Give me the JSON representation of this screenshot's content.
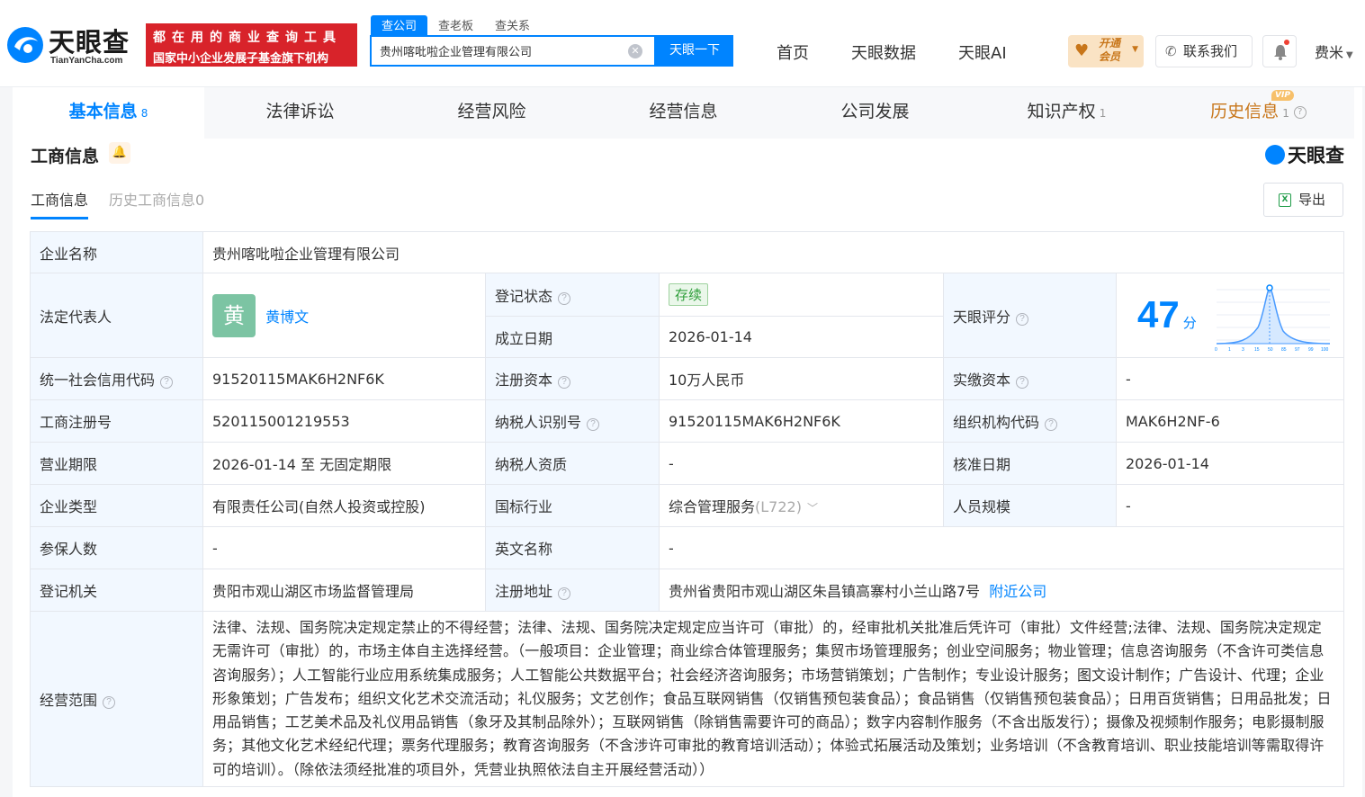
{
  "header": {
    "logo_text": "天眼查",
    "logo_sub": "TianYanCha.com",
    "banner_line1": "都在用的商业查询工具",
    "banner_line2": "国家中小企业发展子基金旗下机构",
    "search_tabs": [
      "查公司",
      "查老板",
      "查关系"
    ],
    "search_value": "贵州喀吡啦企业管理有限公司",
    "search_button": "天眼一下",
    "nav": [
      "首页",
      "天眼数据",
      "天眼AI"
    ],
    "vip_line1": "开通",
    "vip_line2": "会员",
    "contact": "联系我们",
    "user": "费米"
  },
  "main_tabs": [
    {
      "label": "基本信息",
      "count": "8"
    },
    {
      "label": "法律诉讼",
      "count": ""
    },
    {
      "label": "经营风险",
      "count": ""
    },
    {
      "label": "经营信息",
      "count": ""
    },
    {
      "label": "公司发展",
      "count": ""
    },
    {
      "label": "知识产权",
      "count": "1"
    },
    {
      "label": "历史信息",
      "count": "1",
      "badge": "VIP"
    }
  ],
  "section": {
    "title": "工商信息",
    "brand": "天眼查",
    "sub_tabs": [
      "工商信息",
      "历史工商信息0"
    ],
    "export": "导出"
  },
  "info": {
    "company_name_label": "企业名称",
    "company_name": "贵州喀吡啦企业管理有限公司",
    "legal_rep_label": "法定代表人",
    "legal_rep_avatar": "黄",
    "legal_rep": "黄博文",
    "reg_status_label": "登记状态",
    "reg_status": "存续",
    "found_date_label": "成立日期",
    "found_date": "2026-01-14",
    "score_label": "天眼评分",
    "score": "47",
    "score_unit": "分",
    "score_axis": [
      "0",
      "1",
      "3",
      "15",
      "50",
      "85",
      "97",
      "99",
      "100"
    ],
    "credit_code_label": "统一社会信用代码",
    "credit_code": "91520115MAK6H2NF6K",
    "reg_capital_label": "注册资本",
    "reg_capital": "10万人民币",
    "paid_capital_label": "实缴资本",
    "paid_capital": "-",
    "reg_no_label": "工商注册号",
    "reg_no": "520115001219553",
    "tax_id_label": "纳税人识别号",
    "tax_id": "91520115MAK6H2NF6K",
    "org_code_label": "组织机构代码",
    "org_code": "MAK6H2NF-6",
    "term_label": "营业期限",
    "term": "2026-01-14 至 无固定期限",
    "tax_qual_label": "纳税人资质",
    "tax_qual": "-",
    "approve_date_label": "核准日期",
    "approve_date": "2026-01-14",
    "type_label": "企业类型",
    "type": "有限责任公司(自然人投资或控股)",
    "industry_label": "国标行业",
    "industry": "综合管理服务",
    "industry_code": "(L722)",
    "staff_label": "人员规模",
    "staff": "-",
    "insured_label": "参保人数",
    "insured": "-",
    "english_label": "英文名称",
    "english": "-",
    "authority_label": "登记机关",
    "authority": "贵阳市观山湖区市场监督管理局",
    "address_label": "注册地址",
    "address": "贵州省贵阳市观山湖区朱昌镇高寨村小兰山路7号",
    "nearby": "附近公司",
    "scope_label": "经营范围",
    "scope": "法律、法规、国务院决定规定禁止的不得经营；法律、法规、国务院决定规定应当许可（审批）的，经审批机关批准后凭许可（审批）文件经营;法律、法规、国务院决定规定无需许可（审批）的，市场主体自主选择经营。（一般项目：企业管理；商业综合体管理服务；集贸市场管理服务；创业空间服务；物业管理；信息咨询服务（不含许可类信息咨询服务）；人工智能行业应用系统集成服务；人工智能公共数据平台；社会经济咨询服务；市场营销策划；广告制作；专业设计服务；图文设计制作；广告设计、代理；企业形象策划；广告发布；组织文化艺术交流活动；礼仪服务；文艺创作；食品互联网销售（仅销售预包装食品）；食品销售（仅销售预包装食品）；日用百货销售；日用品批发；日用品销售；工艺美术品及礼仪用品销售（象牙及其制品除外）；互联网销售（除销售需要许可的商品）；数字内容制作服务（不含出版发行）；摄像及视频制作服务；电影摄制服务；其他文化艺术经纪代理；票务代理服务；教育咨询服务（不含涉许可审批的教育培训活动）；体验式拓展活动及策划；业务培训（不含教育培训、职业技能培训等需取得许可的培训）。（除依法须经批准的项目外，凭营业执照依法自主开展经营活动））"
  },
  "colors": {
    "accent": "#0084ff",
    "label_bg": "#f2f8ff",
    "banner": "#d8232a",
    "status_green": "#2e9e3a"
  }
}
